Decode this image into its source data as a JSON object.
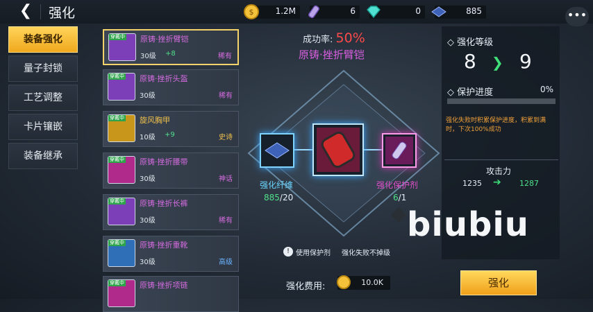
{
  "header": {
    "back_icon": "back-arrow-icon",
    "title": "强化"
  },
  "resources": [
    {
      "icon": "gold-coin-icon",
      "value": "1.2M"
    },
    {
      "icon": "crystal-vial-icon",
      "value": "6"
    },
    {
      "icon": "diamond-icon",
      "value": "0"
    },
    {
      "icon": "fiber-icon",
      "value": "885"
    }
  ],
  "more_icon": "more-options-icon",
  "tabs": [
    {
      "label": "装备强化",
      "active": true
    },
    {
      "label": "量子封锁"
    },
    {
      "label": "工艺调整"
    },
    {
      "label": "卡片镶嵌"
    },
    {
      "label": "装备继承"
    }
  ],
  "items": [
    {
      "name": "原铸·挫折臂铠",
      "level": "30级",
      "plus": "+8",
      "rarity": "稀有",
      "equipped": "穿戴中",
      "selected": true,
      "name_color": "#d56ce0",
      "rarity_color": "#d56ce0",
      "frame": "#7d3fb8"
    },
    {
      "name": "原铸·挫折头盔",
      "level": "30级",
      "plus": "",
      "rarity": "稀有",
      "equipped": "穿戴中",
      "name_color": "#d56ce0",
      "rarity_color": "#d56ce0",
      "frame": "#7d3fb8"
    },
    {
      "name": "旋风胸甲",
      "level": "10级",
      "plus": "+9",
      "rarity": "史诗",
      "equipped": "穿戴中",
      "name_color": "#f2c24c",
      "rarity_color": "#f2c24c",
      "frame": "#c9961c"
    },
    {
      "name": "原铸·挫折腰带",
      "level": "30级",
      "plus": "",
      "rarity": "神话",
      "equipped": "穿戴中",
      "name_color": "#d56ce0",
      "rarity_color": "#d56ce0",
      "frame": "#b02a8c"
    },
    {
      "name": "原铸·挫折长裤",
      "level": "30级",
      "plus": "",
      "rarity": "稀有",
      "equipped": "穿戴中",
      "name_color": "#d56ce0",
      "rarity_color": "#d56ce0",
      "frame": "#7d3fb8"
    },
    {
      "name": "原铸·挫折重靴",
      "level": "30级",
      "plus": "",
      "rarity": "高级",
      "equipped": "穿戴中",
      "name_color": "#d56ce0",
      "rarity_color": "#6ab4ff",
      "frame": "#2f6fb8"
    },
    {
      "name": "原铸·挫折项链",
      "level": "",
      "plus": "",
      "rarity": "",
      "equipped": "穿戴中",
      "name_color": "#d56ce0",
      "rarity_color": "#d56ce0",
      "frame": "#b02a8c"
    }
  ],
  "center": {
    "success_label": "成功率:",
    "success_value": "50%",
    "item_name": "原铸·挫折臂铠",
    "left_slot": {
      "label": "强化纤维",
      "have": "885",
      "need": "/20"
    },
    "right_slot": {
      "label": "强化保护剂",
      "have": "6",
      "need": "/1"
    },
    "option_use": "使用保护剂",
    "option_note": "强化失败不掉级",
    "cost_label": "强化费用:",
    "cost_value": "10.0K"
  },
  "panel": {
    "level_title": "强化等级",
    "level_from": "8",
    "level_to": "9",
    "protect_title": "保护进度",
    "protect_value": "0%",
    "protect_desc": "强化失败时积累保护进度，积累到满时，下次100%成功",
    "attack_title": "攻击力",
    "attack_from": "1235",
    "attack_to": "1287"
  },
  "enhance_button": "强化",
  "watermark": "biubiu"
}
